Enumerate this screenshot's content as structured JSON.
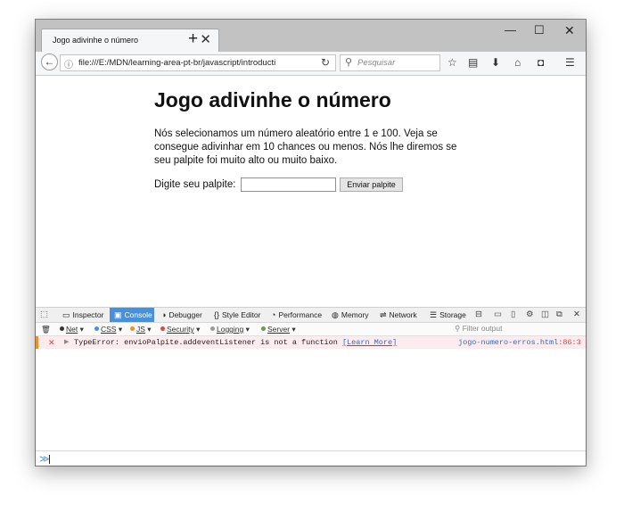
{
  "browser": {
    "tab_title": "Jogo adivinhe o número",
    "tab_close": "✕",
    "new_tab": "+",
    "window_controls": {
      "minimize": "—",
      "maximize": "☐",
      "close": "✕"
    },
    "url": "file:///E:/MDN/learning-area-pt-br/javascript/introducti",
    "search_placeholder": "Pesquisar",
    "icons": [
      "back-icon",
      "info-icon",
      "reload-icon",
      "search-icon",
      "star-icon",
      "reading-list-icon",
      "download-icon",
      "home-icon",
      "pocket-icon",
      "menu-icon"
    ]
  },
  "page": {
    "heading": "Jogo adivinhe o número",
    "paragraph": "Nós selecionamos um número aleatório entre 1 e 100. Veja se consegue adivinhar em 10 chances ou menos. Nós lhe diremos se seu palpite foi muito alto ou muito baixo.",
    "guess_label": "Digite seu palpite:",
    "guess_value": "",
    "submit_label": "Enviar palpite"
  },
  "devtools": {
    "tabs": [
      {
        "label": "Inspector",
        "icon": "inspector-icon"
      },
      {
        "label": "Console",
        "icon": "console-icon",
        "active": true
      },
      {
        "label": "Debugger",
        "icon": "debugger-icon"
      },
      {
        "label": "Style Editor",
        "icon": "style-editor-icon"
      },
      {
        "label": "Performance",
        "icon": "performance-icon"
      },
      {
        "label": "Memory",
        "icon": "memory-icon"
      },
      {
        "label": "Network",
        "icon": "network-icon"
      },
      {
        "label": "Storage",
        "icon": "storage-icon"
      }
    ],
    "filters": [
      {
        "label": "Net",
        "color": "#333333"
      },
      {
        "label": "CSS",
        "color": "#4a90d9"
      },
      {
        "label": "JS",
        "color": "#e8912e"
      },
      {
        "label": "Security",
        "color": "#e0463b"
      },
      {
        "label": "Logging",
        "color": "#9a9a9a"
      },
      {
        "label": "Server",
        "color": "#6a9a4a"
      }
    ],
    "filter_placeholder": "Filter output",
    "error": {
      "message": "TypeError: envioPalpite.addeventListener is not a function",
      "learn_more": "[Learn More]",
      "file": "jogo-numero-erros.html",
      "line": ":86:3"
    },
    "prompt_symbol": "≫"
  },
  "colors": {
    "accent": "#4a90d9",
    "error_bg": "#fdebed",
    "error_marker": "#e8912e",
    "error_text": "#e0463b"
  }
}
